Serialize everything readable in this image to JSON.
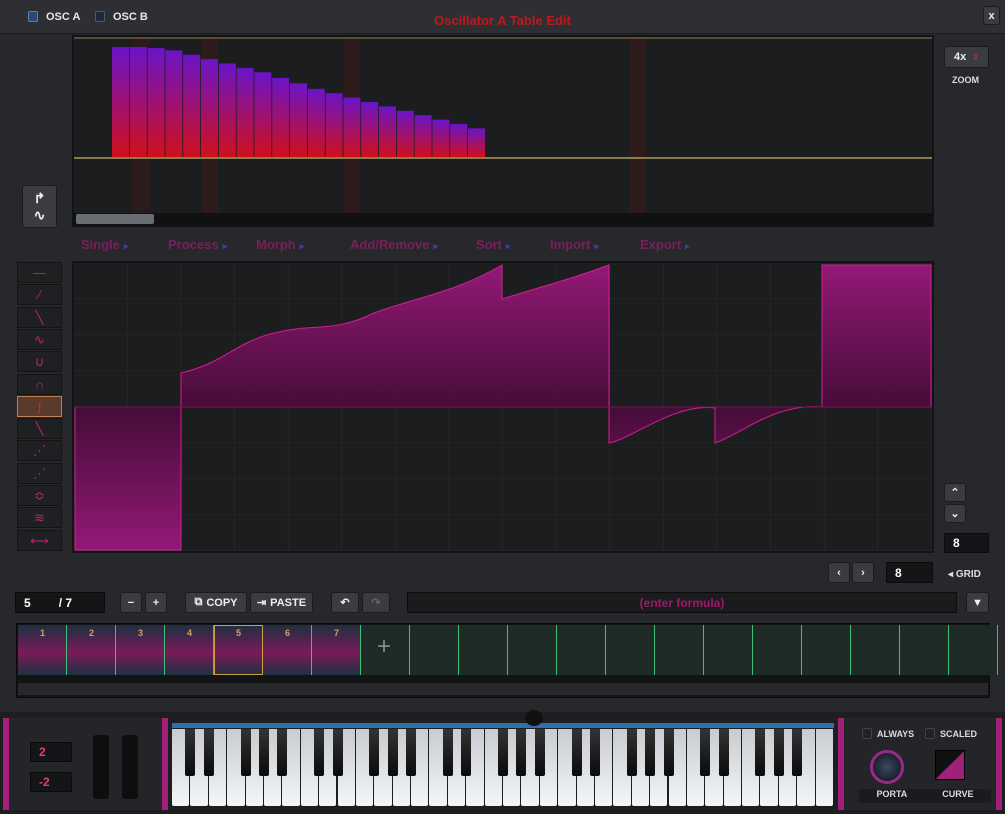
{
  "header": {
    "tabs": [
      {
        "label": "OSC A",
        "checked": true
      },
      {
        "label": "OSC B",
        "checked": false
      }
    ],
    "title": "Oscillator A Table Edit",
    "close_label": "x"
  },
  "zoom": {
    "value": "4x",
    "label": "ZOOM"
  },
  "harmonics": {
    "values": [
      1.0,
      1.0,
      0.99,
      0.97,
      0.93,
      0.89,
      0.85,
      0.81,
      0.77,
      0.72,
      0.67,
      0.62,
      0.58,
      0.54,
      0.5,
      0.46,
      0.42,
      0.38,
      0.34,
      0.3,
      0.26
    ],
    "scroll_fraction": 0.1
  },
  "menus": [
    "Single",
    "Process",
    "Morph",
    "Add/Remove",
    "Sort",
    "Import",
    "Export"
  ],
  "tools": [
    "flat",
    "ramp-up",
    "ramp-down",
    "sine",
    "sine-inverted",
    "arch",
    "s-curve",
    "fall-curve",
    "dotted-ramp-up",
    "dotted-ramp-down",
    "pinch",
    "noise",
    "stretch"
  ],
  "selected_tool": 6,
  "grid": {
    "value": "8",
    "label": "GRID",
    "edit_grid": "8"
  },
  "frames": {
    "current": "5",
    "total": "/ 7",
    "copy": "COPY",
    "paste": "PASTE",
    "formula_placeholder": "(enter formula)",
    "labels": [
      "1",
      "2",
      "3",
      "4",
      "5",
      "6",
      "7"
    ],
    "add": "+"
  },
  "keyboard": {
    "pitch_up": "2",
    "pitch_down": "-2",
    "always": "ALWAYS",
    "scaled": "SCALED",
    "porta": "PORTA",
    "curve": "CURVE"
  },
  "colors": {
    "accent": "#c0186e",
    "title": "#c0181c",
    "slot_border": "#3fc07a"
  }
}
